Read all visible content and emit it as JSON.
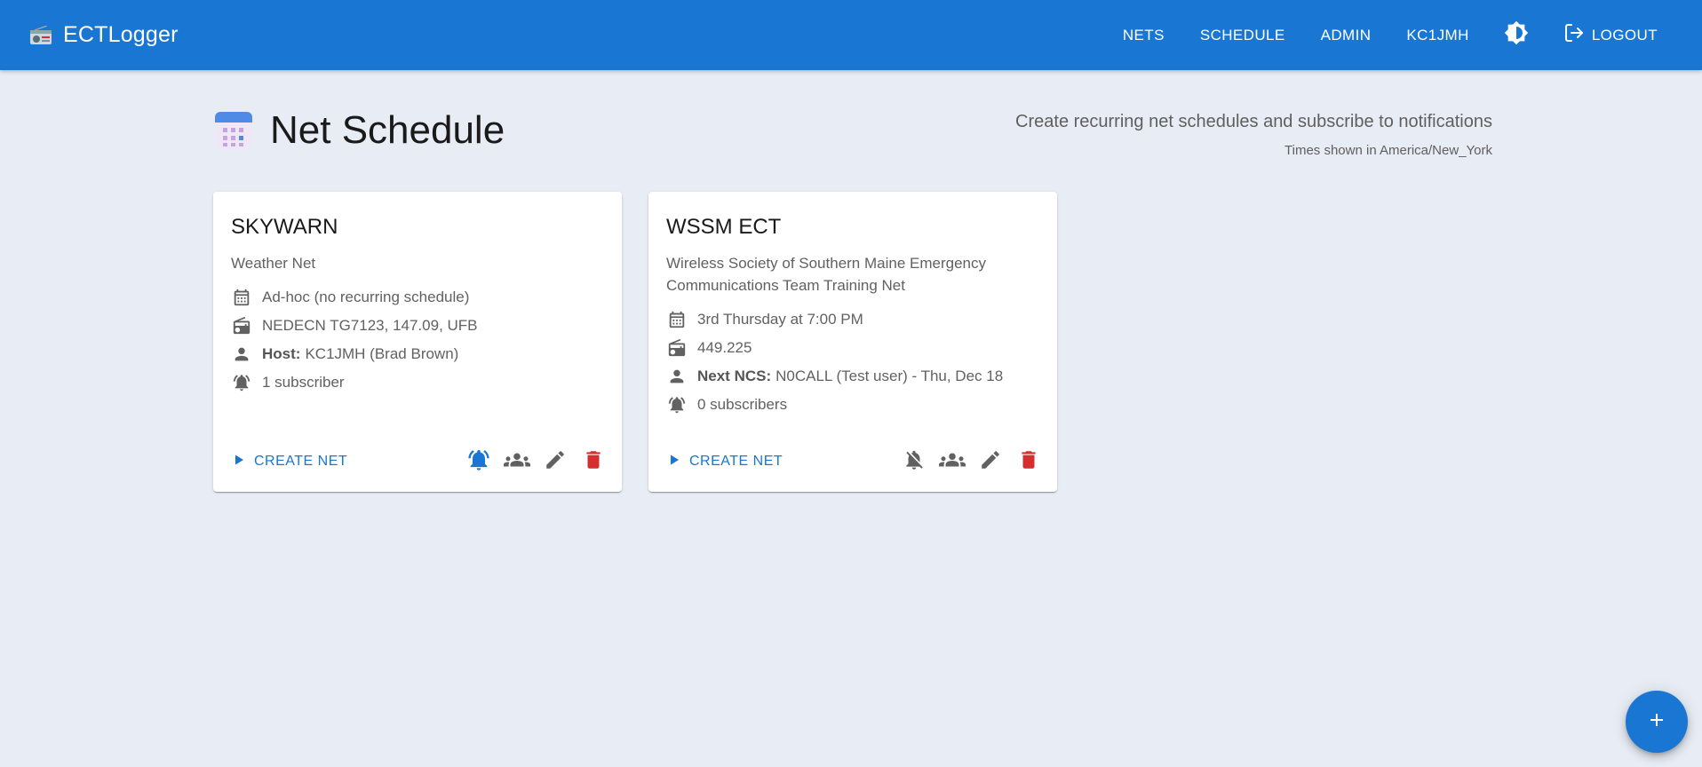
{
  "app": {
    "title": "ECTLogger"
  },
  "nav": {
    "nets": "NETS",
    "schedule": "SCHEDULE",
    "admin": "ADMIN",
    "user": "KC1JMH",
    "logout": "LOGOUT"
  },
  "header": {
    "title": "Net Schedule",
    "subtitle": "Create recurring net schedules and subscribe to notifications",
    "timezone_note": "Times shown in America/New_York"
  },
  "cards": [
    {
      "name": "SKYWARN",
      "description": "Weather Net",
      "schedule": "Ad-hoc (no recurring schedule)",
      "frequency": "NEDECN TG7123, 147.09, UFB",
      "person_label": "Host:",
      "person_value": "KC1JMH (Brad Brown)",
      "subscribers": "1 subscriber",
      "create_label": "CREATE NET",
      "subscribed": true
    },
    {
      "name": "WSSM ECT",
      "description": "Wireless Society of Southern Maine Emergency Communications Team Training Net",
      "schedule": "3rd Thursday at 7:00 PM",
      "frequency": "449.225",
      "person_label": "Next NCS:",
      "person_value": "N0CALL (Test user) - Thu, Dec 18",
      "subscribers": "0 subscribers",
      "create_label": "CREATE NET",
      "subscribed": false
    }
  ],
  "colors": {
    "primary": "#1976d2",
    "background": "#e8ecf4",
    "danger": "#d32f2f",
    "icon": "#616161"
  },
  "icons": {
    "brand": "radio-icon",
    "header": "calendar-icon",
    "theme": "brightness-icon",
    "logout": "logout-icon",
    "fab": "add-icon"
  }
}
